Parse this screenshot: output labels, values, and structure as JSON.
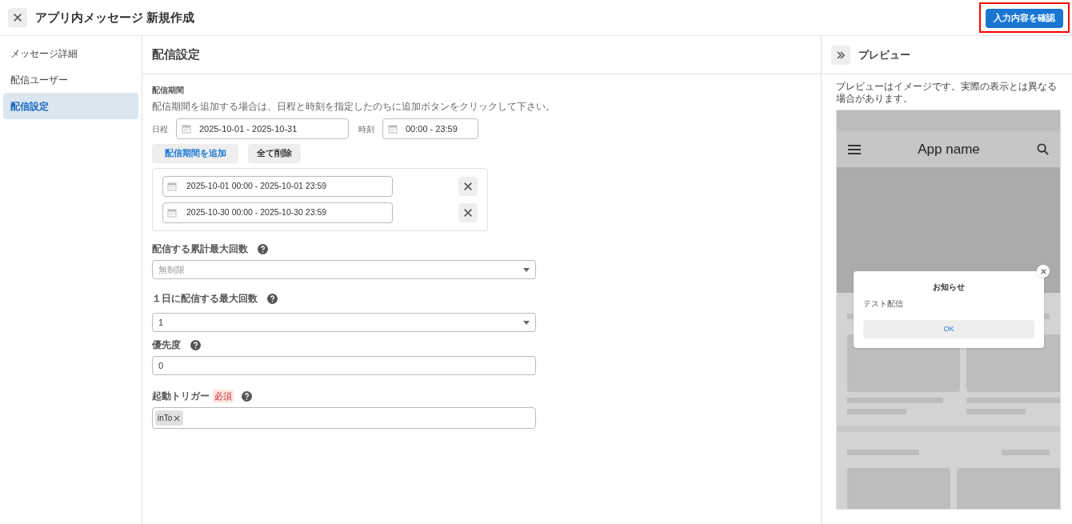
{
  "header": {
    "title": "アプリ内メッセージ 新規作成",
    "confirm_button": "入力内容を確認"
  },
  "sidebar": {
    "items": [
      {
        "label": "メッセージ詳細",
        "selected": false
      },
      {
        "label": "配信ユーザー",
        "selected": false
      },
      {
        "label": "配信設定",
        "selected": true
      }
    ]
  },
  "section": {
    "title": "配信設定"
  },
  "period": {
    "label": "配信期間",
    "help": "配信期間を追加する場合は、日程と時刻を指定したのちに追加ボタンをクリックして下さい。",
    "date_label": "日程",
    "date_value": "2025-10-01 - 2025-10-31",
    "time_label": "時刻",
    "time_value": "00:00 - 23:59",
    "add_button": "配信期間を追加",
    "clear_button": "全て削除",
    "entries": [
      "2025-10-01 00:00 - 2025-10-01 23:59",
      "2025-10-30 00:00 - 2025-10-30 23:59"
    ]
  },
  "fields": [
    {
      "kind": "select",
      "label": "配信する累計最大回数",
      "placeholder": "無制限"
    },
    {
      "kind": "select",
      "label": "１日に配信する最大回数",
      "value": "1"
    },
    {
      "kind": "text",
      "label": "優先度",
      "value": "0"
    },
    {
      "kind": "tags",
      "label": "起動トリガー",
      "required": "必須",
      "tags": [
        "inTo"
      ]
    }
  ],
  "preview": {
    "title": "プレビュー",
    "note": "プレビューはイメージです。実際の表示とは異なる場合があります。",
    "app_name": "App name",
    "dialog": {
      "title": "お知らせ",
      "body": "テスト配信",
      "button": "OK"
    }
  }
}
